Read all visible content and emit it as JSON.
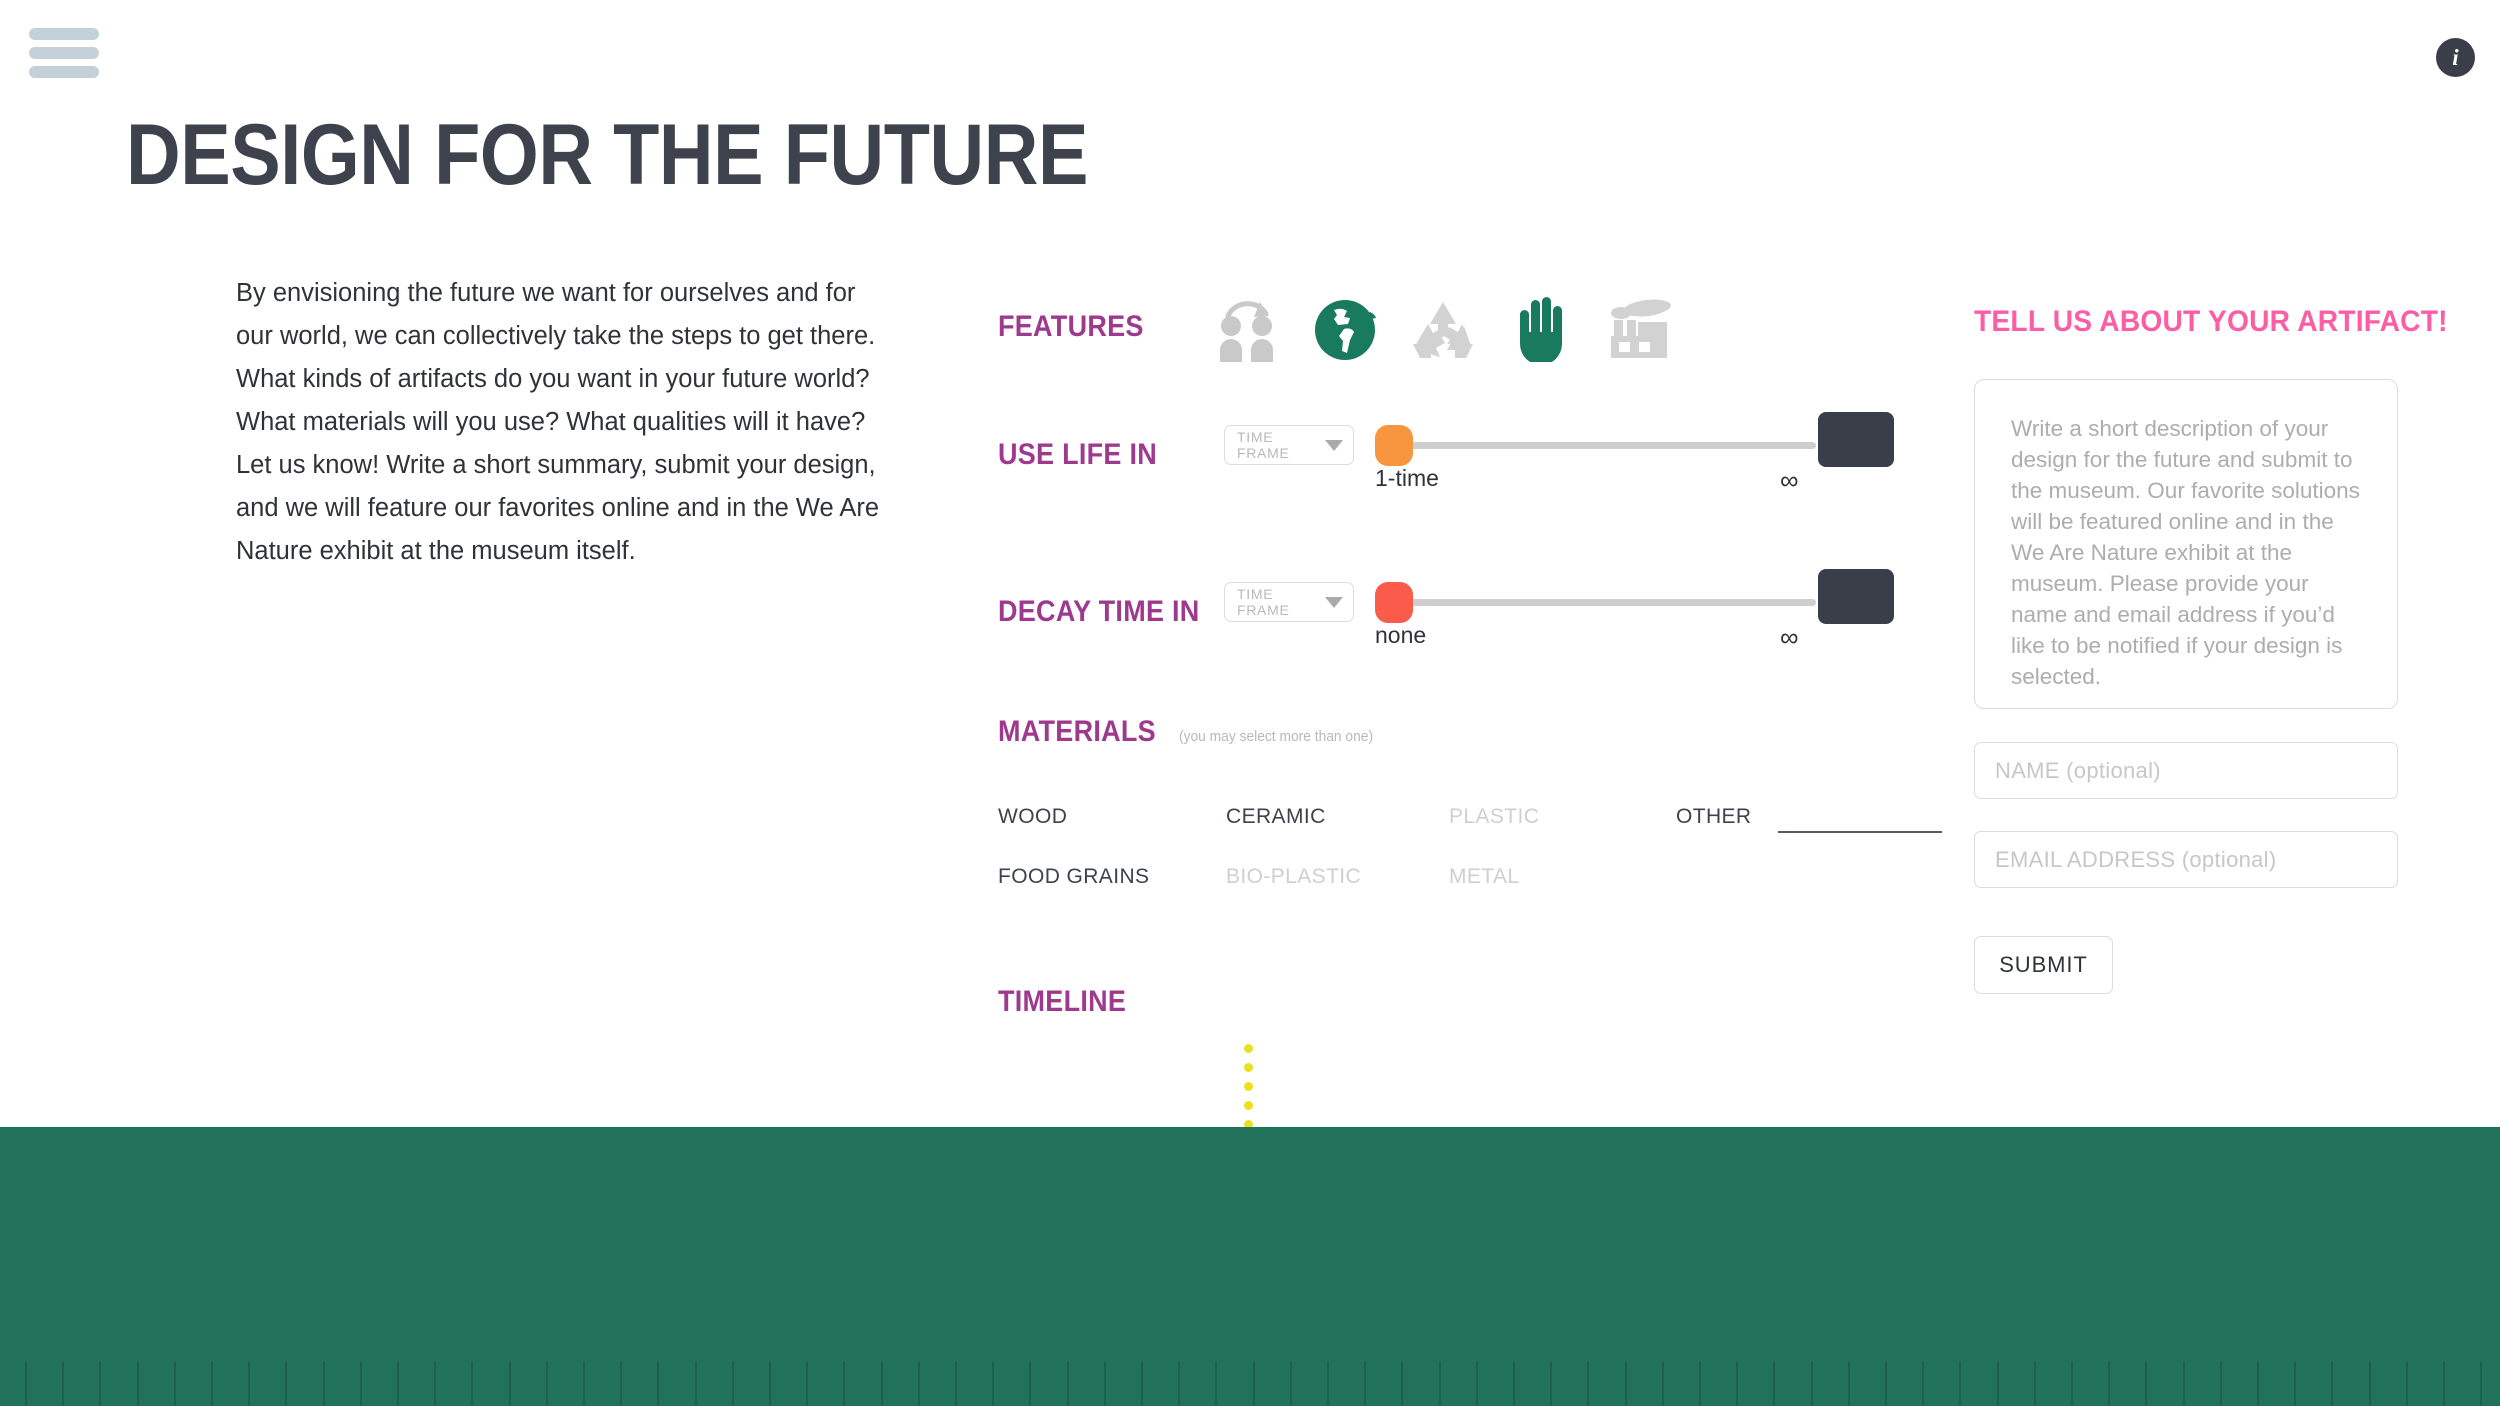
{
  "header": {
    "menu_icon": "hamburger-menu-icon",
    "info_icon": "i",
    "title": "DESIGN FOR THE FUTURE"
  },
  "intro": {
    "paragraph": "By envisioning the future we want for ourselves and for our world, we can collectively take the steps to get there.  What kinds of artifacts do you want in your future world? What materials will you use? What qualities will it have? Let us know! Write a short summary, submit your design, and we will feature our favorites online and in the We Are Nature exhibit at the museum itself."
  },
  "form": {
    "features": {
      "label": "FEATURES",
      "icons": [
        {
          "name": "two-people-sharing-icon",
          "selected": false
        },
        {
          "name": "globe-icon",
          "selected": true
        },
        {
          "name": "recycle-icon",
          "selected": false
        },
        {
          "name": "hand-icon",
          "selected": true
        },
        {
          "name": "factory-icon",
          "selected": false
        }
      ]
    },
    "use_life": {
      "label": "USE LIFE IN",
      "select_value": "TIME FRAME",
      "min_label": "1-time",
      "max_label": "∞",
      "value_percent": 0
    },
    "decay_time": {
      "label": "DECAY TIME IN",
      "select_value": "TIME FRAME",
      "min_label": "none",
      "max_label": "∞",
      "value_percent": 0
    },
    "materials": {
      "label": "MATERIALS",
      "hint": "(you may select more than one)",
      "rows": [
        [
          {
            "label": "WOOD",
            "selected": true
          },
          {
            "label": "CERAMIC",
            "selected": true
          },
          {
            "label": "PLASTIC",
            "selected": false
          },
          {
            "label": "OTHER",
            "selected": true
          }
        ],
        [
          {
            "label": "FOOD GRAINS",
            "selected": true
          },
          {
            "label": "BIO-PLASTIC",
            "selected": false
          },
          {
            "label": "METAL",
            "selected": false
          }
        ]
      ]
    },
    "timeline": {
      "label": "TIMELINE"
    }
  },
  "right_panel": {
    "title": "TELL US ABOUT YOUR ARTIFACT!",
    "description_placeholder": "Write a short description of your design for the future and submit to the museum. Our favorite solutions will be featured online and in the We Are Nature exhibit at the museum. Please provide your name and email address if you’d like to be notified if your design is selected.",
    "description_value": "",
    "name_placeholder": "NAME (optional)",
    "name_value": "",
    "email_placeholder": "EMAIL ADDRESS (optional)",
    "email_value": "",
    "submit_label": "SUBMIT"
  },
  "colors": {
    "accent_purple": "#9e3a8e",
    "accent_pink": "#fb5ea4",
    "green": "#22715a",
    "dark": "#3a3e48",
    "orange_thumb": "#f7963f",
    "red_thumb": "#fb5b4b",
    "yellow_dot": "#e9e11f"
  }
}
